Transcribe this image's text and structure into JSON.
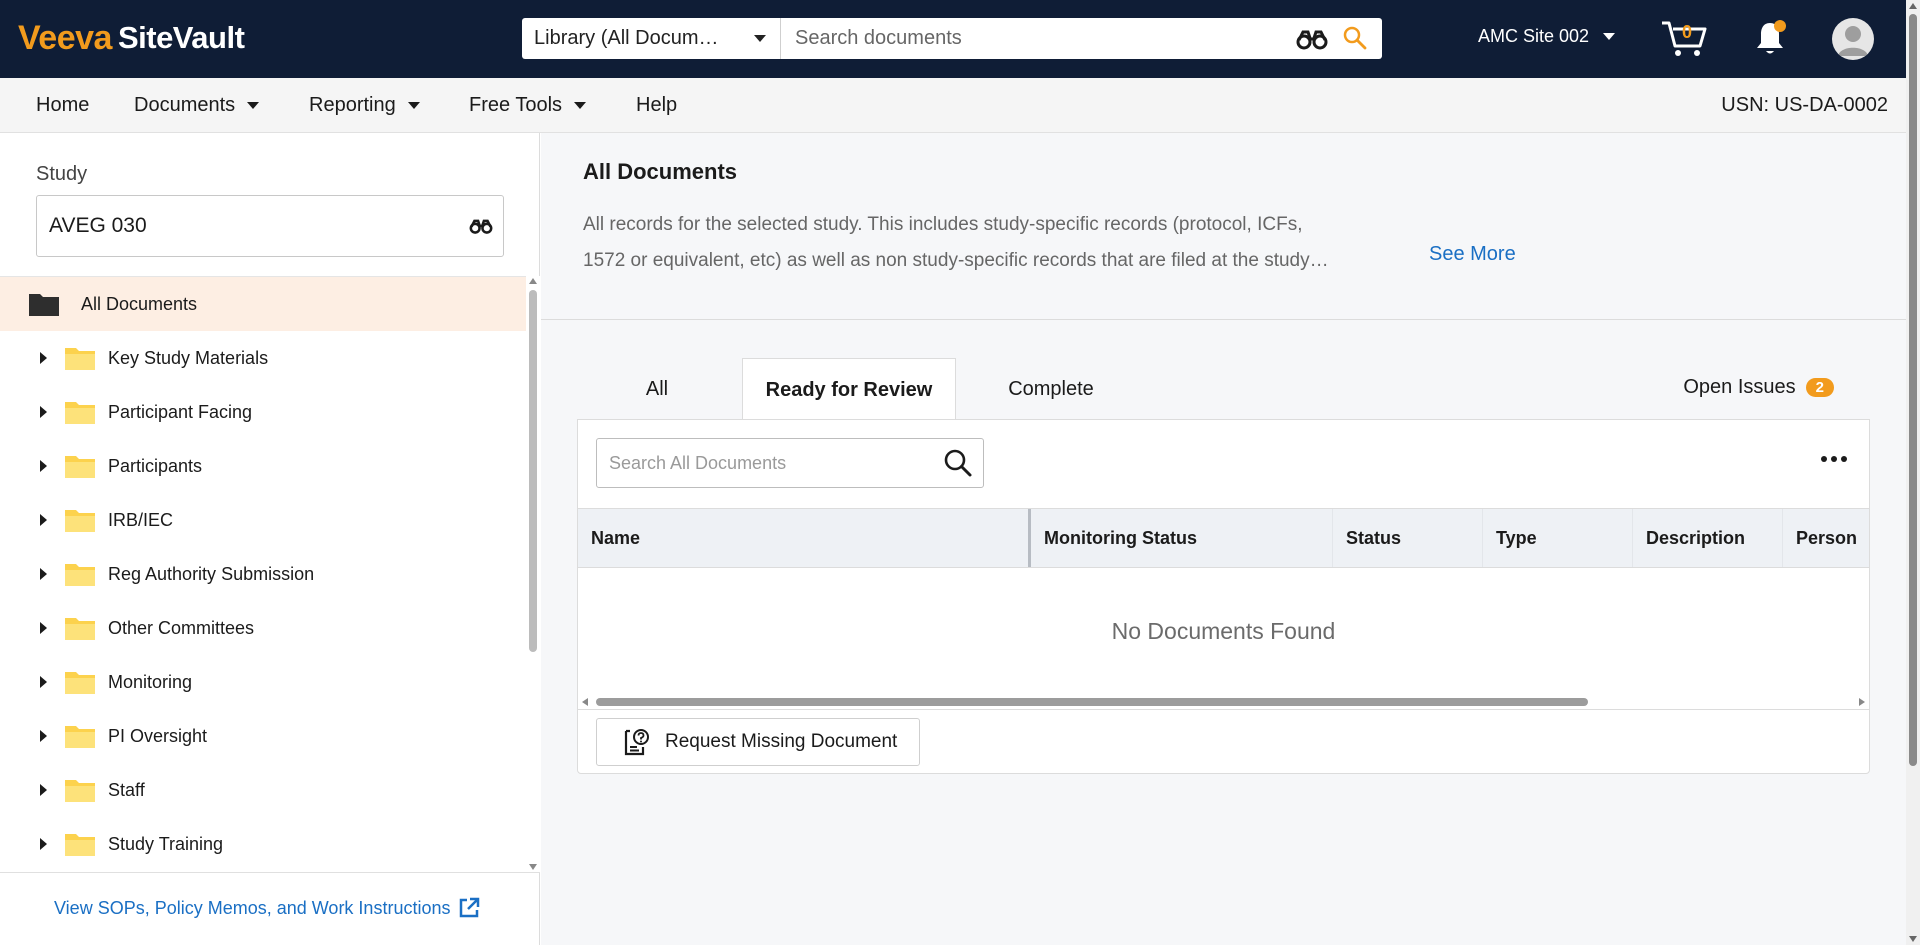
{
  "header": {
    "brand_primary": "Veeva",
    "brand_secondary": "SiteVault",
    "library_select": "Library (All Docum…",
    "search_placeholder": "Search documents",
    "site_select": "AMC Site 002",
    "cart_count": "0",
    "colors": {
      "bar": "#0f1d36",
      "accent": "#f29b1d"
    }
  },
  "nav": {
    "items": [
      {
        "label": "Home",
        "dropdown": false
      },
      {
        "label": "Documents",
        "dropdown": true
      },
      {
        "label": "Reporting",
        "dropdown": true
      },
      {
        "label": "Free Tools",
        "dropdown": true
      },
      {
        "label": "Help",
        "dropdown": false
      }
    ],
    "usn": "USN: US-DA-0002"
  },
  "sidebar": {
    "study_label": "Study",
    "study_value": "AVEG 030",
    "tree": [
      {
        "label": "All Documents",
        "selected": true,
        "icon": "folder-dark-icon"
      },
      {
        "label": "Key Study Materials",
        "icon": "folder-icon"
      },
      {
        "label": "Participant Facing",
        "icon": "folder-icon"
      },
      {
        "label": "Participants",
        "icon": "folder-icon"
      },
      {
        "label": "IRB/IEC",
        "icon": "folder-icon"
      },
      {
        "label": "Reg Authority Submission",
        "icon": "folder-icon"
      },
      {
        "label": "Other Committees",
        "icon": "folder-icon"
      },
      {
        "label": "Monitoring",
        "icon": "folder-icon"
      },
      {
        "label": "PI Oversight",
        "icon": "folder-icon"
      },
      {
        "label": "Staff",
        "icon": "folder-icon"
      },
      {
        "label": "Study Training",
        "icon": "folder-icon"
      }
    ],
    "sop_link": "View SOPs, Policy Memos, and Work Instructions"
  },
  "main": {
    "title": "All Documents",
    "description_line1": "All records for the selected study. This includes study-specific records (protocol, ICFs,",
    "description_line2": "1572 or equivalent, etc) as well as non study-specific records that are filed at the study…",
    "see_more": "See More",
    "tabs": [
      {
        "label": "All",
        "active": false
      },
      {
        "label": "Ready for Review",
        "active": true
      },
      {
        "label": "Complete",
        "active": false
      }
    ],
    "open_issues_label": "Open Issues",
    "open_issues_count": "2",
    "doc_search_placeholder": "Search All Documents",
    "columns": [
      "Name",
      "Monitoring Status",
      "Status",
      "Type",
      "Description",
      "Person"
    ],
    "empty_message": "No Documents Found",
    "request_button": "Request Missing Document"
  }
}
